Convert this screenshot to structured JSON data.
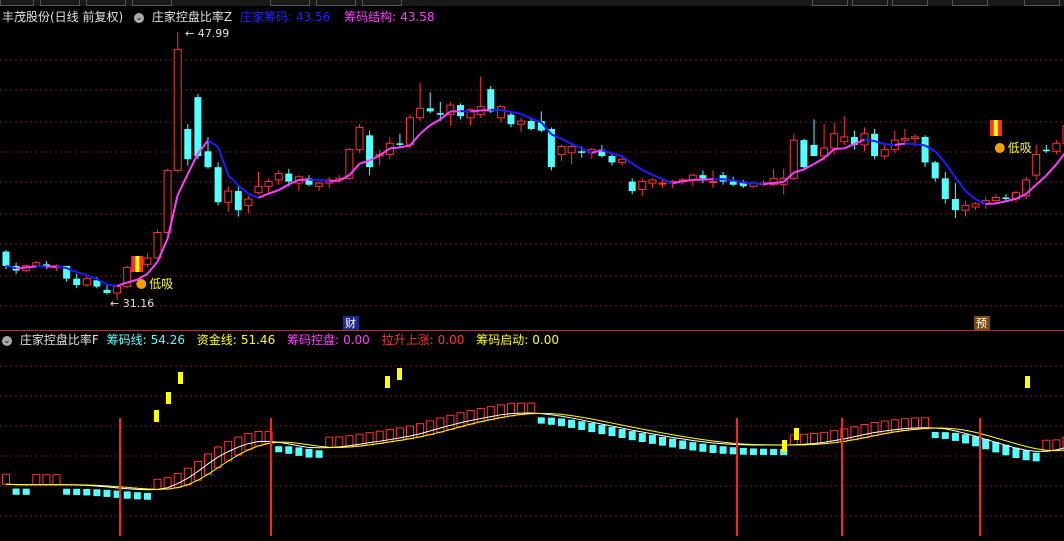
{
  "upper": {
    "stock_name": "丰茂股份(日线 前复权)",
    "indicator": "庄家控盘比率Z",
    "chip_label": "庄家筹码:",
    "chip_value": "43.56",
    "struct_label": "筹码结构:",
    "struct_value": "43.58",
    "high_label": "47.99",
    "low_label": "31.16",
    "signal_label": "低吸",
    "event_cai": "财",
    "event_yu": "预"
  },
  "lower": {
    "indicator": "庄家控盘比率F",
    "chip_line_label": "筹码线:",
    "chip_line_value": "54.26",
    "fund_line_label": "资金线:",
    "fund_line_value": "51.46",
    "control_label": "筹码控盘:",
    "control_value": "0.00",
    "rise_label": "拉升上涨:",
    "rise_value": "0.00",
    "start_label": "筹码启动:",
    "start_value": "0.00"
  },
  "colors": {
    "up": "#ff3232",
    "down": "#54ffff",
    "ma_low": "#ff3cff",
    "ma_high": "#1c1cff",
    "chip_line": "#ffffff",
    "fund_line": "#ffff00",
    "grid": "#7a1a1a",
    "signal": "#ffff00",
    "vert_line": "#ff2020"
  },
  "chart_data": [
    {
      "type": "candlestick",
      "title": "庄家控盘比率Z",
      "price_range": [
        31.16,
        47.99
      ],
      "x": [
        1,
        2,
        3,
        4,
        5,
        6,
        7,
        8,
        9,
        10,
        11,
        12,
        13,
        14,
        15,
        16,
        17,
        18,
        19,
        20,
        21,
        22,
        23,
        24,
        25,
        26,
        27,
        28,
        29,
        30,
        31,
        32,
        33,
        34,
        35,
        36,
        37,
        38,
        39,
        40,
        41,
        42,
        43,
        44,
        45,
        46,
        47,
        48,
        49,
        50,
        51,
        52,
        53,
        54,
        55,
        56,
        57,
        58,
        59,
        60,
        61,
        62,
        63,
        64,
        65,
        66,
        67,
        68,
        69,
        70,
        71,
        72,
        73,
        74,
        75,
        76,
        77,
        78,
        79,
        80,
        81,
        82,
        83,
        84,
        85,
        86,
        87,
        88,
        89,
        90,
        91,
        92,
        93,
        94,
        95,
        96,
        97,
        98,
        99,
        100,
        101,
        102,
        103
      ],
      "ohlc": [
        [
          34.2,
          34.3,
          33.1,
          33.3
        ],
        [
          33.3,
          33.5,
          32.8,
          33.0
        ],
        [
          33.0,
          33.4,
          32.9,
          33.3
        ],
        [
          33.3,
          33.6,
          33.2,
          33.5
        ],
        [
          33.4,
          33.6,
          33.1,
          33.2
        ],
        [
          33.2,
          33.4,
          33.0,
          33.3
        ],
        [
          33.3,
          33.3,
          32.3,
          32.5
        ],
        [
          32.5,
          32.8,
          31.9,
          32.1
        ],
        [
          32.1,
          32.7,
          32.0,
          32.5
        ],
        [
          32.4,
          32.6,
          31.9,
          32.0
        ],
        [
          31.8,
          32.1,
          31.5,
          31.6
        ],
        [
          31.6,
          32.1,
          31.16,
          32.0
        ],
        [
          32.0,
          33.3,
          31.9,
          33.2
        ],
        [
          33.2,
          33.6,
          32.9,
          33.4
        ],
        [
          33.4,
          34.1,
          33.2,
          33.8
        ],
        [
          33.8,
          35.6,
          33.7,
          35.4
        ],
        [
          35.4,
          39.4,
          35.3,
          39.3
        ],
        [
          39.3,
          47.99,
          39.2,
          46.9
        ],
        [
          41.9,
          42.2,
          39.6,
          40.0
        ],
        [
          43.9,
          44.1,
          40.0,
          40.2
        ],
        [
          40.5,
          41.4,
          39.4,
          39.5
        ],
        [
          39.5,
          39.8,
          37.1,
          37.3
        ],
        [
          37.3,
          38.3,
          36.7,
          38.0
        ],
        [
          38.0,
          38.3,
          36.4,
          36.8
        ],
        [
          37.1,
          37.7,
          36.6,
          37.5
        ],
        [
          37.9,
          39.2,
          37.8,
          38.3
        ],
        [
          38.3,
          38.8,
          37.9,
          38.6
        ],
        [
          38.7,
          39.3,
          38.4,
          39.1
        ],
        [
          39.1,
          39.4,
          38.3,
          38.6
        ],
        [
          38.5,
          39.0,
          38.0,
          38.9
        ],
        [
          38.8,
          39.0,
          38.3,
          38.4
        ],
        [
          38.3,
          38.6,
          38.0,
          38.5
        ],
        [
          38.5,
          38.9,
          38.2,
          38.7
        ],
        [
          38.7,
          39.0,
          38.5,
          38.8
        ],
        [
          38.8,
          40.7,
          38.7,
          40.6
        ],
        [
          40.6,
          42.2,
          40.4,
          42.0
        ],
        [
          41.5,
          41.8,
          39.0,
          39.5
        ],
        [
          40.2,
          40.6,
          39.6,
          40.3
        ],
        [
          40.3,
          41.4,
          40.0,
          41.0
        ],
        [
          41.0,
          41.6,
          40.7,
          40.9
        ],
        [
          40.9,
          42.8,
          40.7,
          42.6
        ],
        [
          42.6,
          44.8,
          42.4,
          43.2
        ],
        [
          43.2,
          44.2,
          42.9,
          43.0
        ],
        [
          42.9,
          43.6,
          42.4,
          42.8
        ],
        [
          42.8,
          43.6,
          42.1,
          43.4
        ],
        [
          43.4,
          43.5,
          42.5,
          42.7
        ],
        [
          42.6,
          43.2,
          42.1,
          43.1
        ],
        [
          42.8,
          45.2,
          42.6,
          43.3
        ],
        [
          44.4,
          44.6,
          42.9,
          43.0
        ],
        [
          42.6,
          43.4,
          42.3,
          43.3
        ],
        [
          42.8,
          43.0,
          42.0,
          42.2
        ],
        [
          42.2,
          42.6,
          41.7,
          42.4
        ],
        [
          42.4,
          42.6,
          41.8,
          41.9
        ],
        [
          42.4,
          43.0,
          41.7,
          41.8
        ],
        [
          41.9,
          42.0,
          39.3,
          39.5
        ],
        [
          40.3,
          40.9,
          39.9,
          40.8
        ],
        [
          40.4,
          41.0,
          39.7,
          40.8
        ],
        [
          40.5,
          40.8,
          40.1,
          40.4
        ],
        [
          40.4,
          40.7,
          40.0,
          40.6
        ],
        [
          40.6,
          40.9,
          40.1,
          40.2
        ],
        [
          40.2,
          40.3,
          39.6,
          39.8
        ],
        [
          39.8,
          40.2,
          39.6,
          40.0
        ],
        [
          38.6,
          38.8,
          37.8,
          38.0
        ],
        [
          38.1,
          38.8,
          37.7,
          38.6
        ],
        [
          38.5,
          38.8,
          38.2,
          38.7
        ],
        [
          38.5,
          38.7,
          38.2,
          38.5
        ],
        [
          38.5,
          38.7,
          38.2,
          38.6
        ],
        [
          38.6,
          38.8,
          38.4,
          38.7
        ],
        [
          38.7,
          39.1,
          38.3,
          39.0
        ],
        [
          39.0,
          39.3,
          38.5,
          38.8
        ],
        [
          38.6,
          39.3,
          38.2,
          38.6
        ],
        [
          39.0,
          39.2,
          38.4,
          38.6
        ],
        [
          38.6,
          38.9,
          38.3,
          38.4
        ],
        [
          38.6,
          38.7,
          38.2,
          38.3
        ],
        [
          38.3,
          38.6,
          38.2,
          38.5
        ],
        [
          38.4,
          38.7,
          38.3,
          38.5
        ],
        [
          38.4,
          39.4,
          38.3,
          38.8
        ],
        [
          38.4,
          39.4,
          37.8,
          38.8
        ],
        [
          38.8,
          41.6,
          38.7,
          41.2
        ],
        [
          41.2,
          41.3,
          39.3,
          39.5
        ],
        [
          40.9,
          42.5,
          40.7,
          40.2
        ],
        [
          40.2,
          42.2,
          39.9,
          40.7
        ],
        [
          40.7,
          42.3,
          40.3,
          41.6
        ],
        [
          41.1,
          42.7,
          40.9,
          41.4
        ],
        [
          41.4,
          41.8,
          40.6,
          40.9
        ],
        [
          40.9,
          42.0,
          40.5,
          41.6
        ],
        [
          41.6,
          41.9,
          40.0,
          40.2
        ],
        [
          40.2,
          40.9,
          40.0,
          40.6
        ],
        [
          40.6,
          41.8,
          40.4,
          41.2
        ],
        [
          41.2,
          41.9,
          40.9,
          41.3
        ],
        [
          41.3,
          41.6,
          40.8,
          41.4
        ],
        [
          41.4,
          41.5,
          39.5,
          39.8
        ],
        [
          39.8,
          39.9,
          38.6,
          38.8
        ],
        [
          38.8,
          39.2,
          37.2,
          37.5
        ],
        [
          37.5,
          38.5,
          36.3,
          36.8
        ],
        [
          36.8,
          37.4,
          36.4,
          37.1
        ],
        [
          37.0,
          37.3,
          36.8,
          37.2
        ],
        [
          37.2,
          37.6,
          36.9,
          37.4
        ],
        [
          37.4,
          37.8,
          37.2,
          37.6
        ],
        [
          37.6,
          37.8,
          37.3,
          37.5
        ],
        [
          37.5,
          38.0,
          37.3,
          37.9
        ],
        [
          37.7,
          38.9,
          37.5,
          38.7
        ],
        [
          39.0,
          40.9,
          38.7,
          40.3
        ]
      ],
      "extra": [
        [
          40.6,
          40.9,
          40.4,
          40.5
        ],
        [
          40.5,
          41.2,
          40.3,
          41.0
        ],
        [
          41.0,
          42.4,
          40.8,
          42.1
        ],
        [
          42.3,
          43.1,
          42.0,
          42.8
        ],
        [
          42.8,
          43.4,
          42.1,
          42.3
        ],
        [
          42.3,
          43.2,
          41.1,
          41.4
        ]
      ],
      "signals": [
        {
          "x": 14,
          "label": "低吸"
        },
        {
          "x": 99,
          "label": "低吸"
        }
      ]
    },
    {
      "type": "bar",
      "title": "庄家控盘比率F",
      "series": [
        {
          "name": "筹码线",
          "value": 54.26
        },
        {
          "name": "资金线",
          "value": 51.46
        },
        {
          "name": "筹码控盘",
          "value": 0.0
        },
        {
          "name": "拉升上涨",
          "value": 0.0
        },
        {
          "name": "筹码启动",
          "value": 0.0
        }
      ]
    }
  ]
}
